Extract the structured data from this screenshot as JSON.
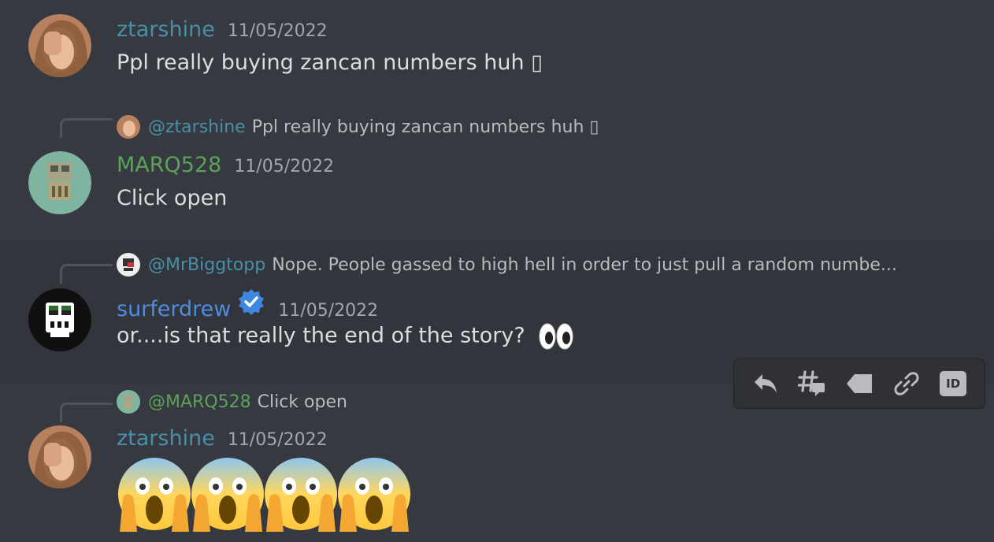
{
  "messages": [
    {
      "author": "ztarshine",
      "author_color": "#4a8fa8",
      "timestamp": "11/05/2022",
      "text": "Ppl really buying zancan numbers huh ▯"
    },
    {
      "reply": {
        "mention": "@ztarshine",
        "mention_color": "#4a8fa8",
        "text": "Ppl really buying zancan numbers huh ▯"
      },
      "author": "MARQ528",
      "author_color": "#5ca05c",
      "timestamp": "11/05/2022",
      "text": "Click open"
    },
    {
      "reply": {
        "mention": "@MrBiggtopp",
        "mention_color": "#4a8fa8",
        "text": "Nope. People gassed to high hell in order to just pull a random numbe..."
      },
      "author": "surferdrew",
      "author_color": "#4e8ce0",
      "timestamp": "11/05/2022",
      "text": "or....is that really the end of the story?"
    },
    {
      "reply": {
        "mention": "@MARQ528",
        "mention_color": "#5ca05c",
        "text": "Click open"
      },
      "author": "ztarshine",
      "author_color": "#4a8fa8",
      "timestamp": "11/05/2022",
      "emoji_count": 4,
      "emoji": "screaming-face"
    }
  ],
  "toolbar": {
    "buttons": [
      "reply-icon",
      "thread-icon",
      "tag-icon",
      "link-icon",
      "id-icon"
    ],
    "id_label": "ID"
  }
}
